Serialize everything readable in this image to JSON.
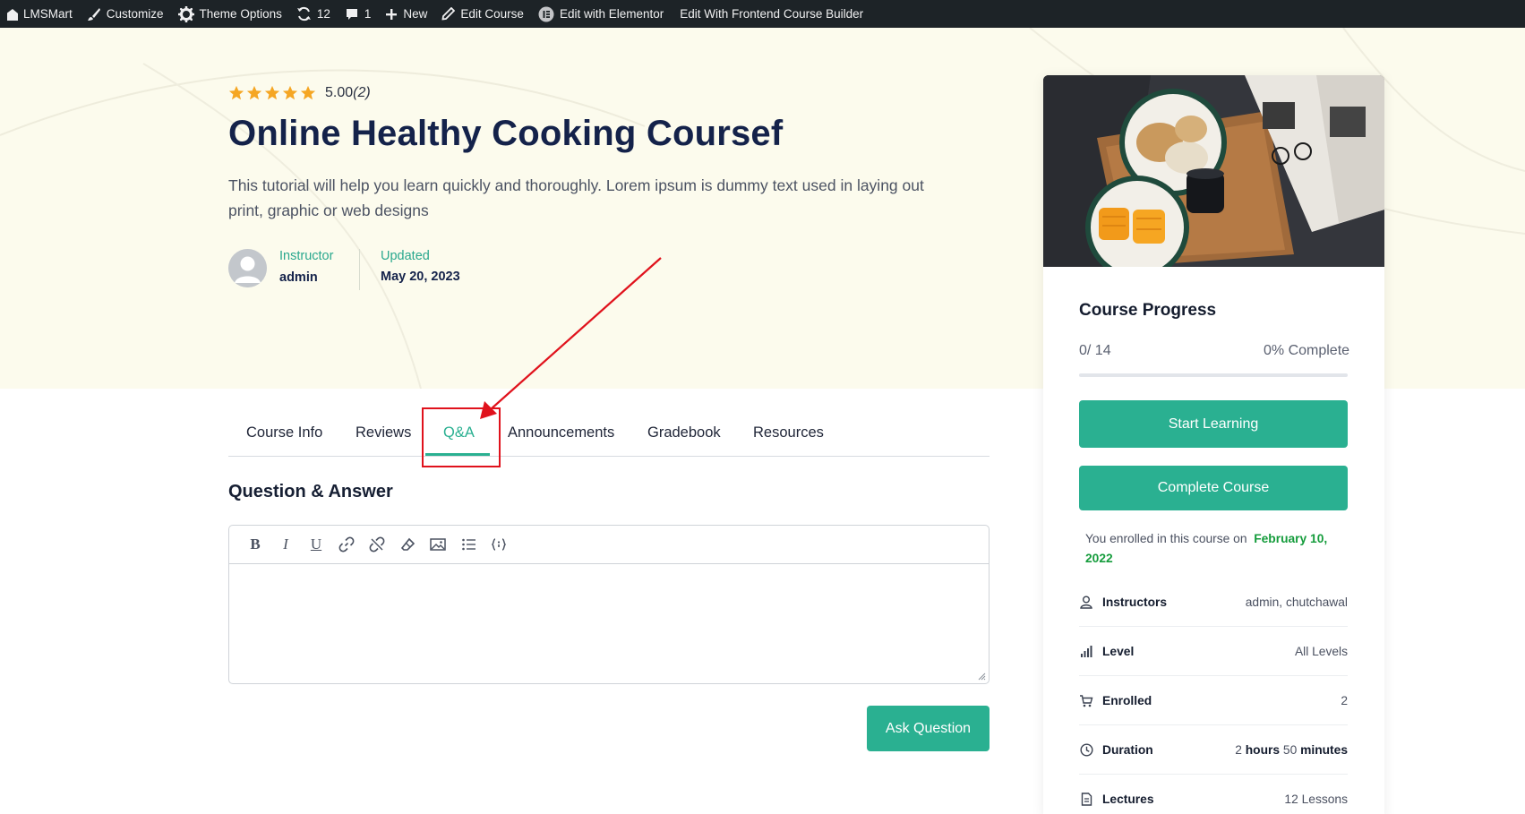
{
  "admin_bar": {
    "site": "LMSMart",
    "customize": "Customize",
    "theme_options": "Theme Options",
    "updates_count": "12",
    "comments_count": "1",
    "new": "New",
    "edit_course": "Edit Course",
    "edit_elementor": "Edit with Elementor",
    "edit_frontend": "Edit With Frontend Course Builder"
  },
  "course": {
    "rating_value": "5.00",
    "rating_count": "(2)",
    "title": "Online Healthy Cooking Coursef",
    "description": "This tutorial will help you learn quickly and thoroughly. Lorem ipsum is dummy text used in laying out print, graphic or web designs",
    "instructor_label": "Instructor",
    "instructor_name": "admin",
    "updated_label": "Updated",
    "updated_date": "May 20, 2023"
  },
  "tabs": [
    {
      "label": "Course Info"
    },
    {
      "label": "Reviews"
    },
    {
      "label": "Q&A"
    },
    {
      "label": "Announcements"
    },
    {
      "label": "Gradebook"
    },
    {
      "label": "Resources"
    }
  ],
  "qa": {
    "section_title": "Question & Answer",
    "ask_button": "Ask Question"
  },
  "sidebar": {
    "progress_title": "Course Progress",
    "progress_count": "0/ 14",
    "progress_percent_text": "0% Complete",
    "progress_fraction": 0,
    "start_button": "Start Learning",
    "complete_button": "Complete Course",
    "enroll_text": "You enrolled in this course on",
    "enroll_date": "February 10, 2022",
    "info": [
      {
        "label": "Instructors",
        "value": "admin, chutchawal"
      },
      {
        "label": "Level",
        "value": "All Levels"
      },
      {
        "label": "Enrolled",
        "value": "2"
      },
      {
        "label": "Duration",
        "hours": "2",
        "hours_unit": "hours",
        "minutes": "50",
        "minutes_unit": "minutes"
      },
      {
        "label": "Lectures",
        "value": "12 Lessons"
      }
    ]
  },
  "colors": {
    "accent": "#2ab091",
    "hero_bg": "#fcfbed",
    "admin_bar_bg": "#1d2327",
    "title": "#14224a",
    "highlight": "#e0121c",
    "star": "#f5a623"
  }
}
